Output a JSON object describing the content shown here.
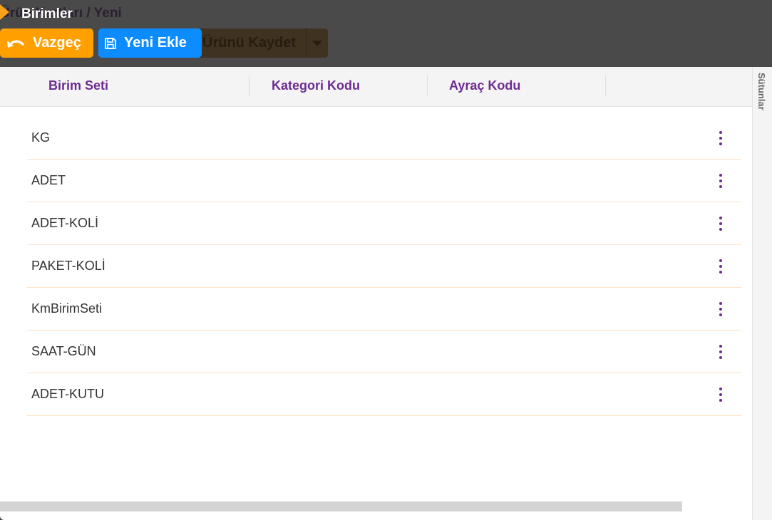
{
  "background": {
    "breadcrumb": "Ürün Kartları / Yeni",
    "save_button_label": "Ürünü Kaydet"
  },
  "modal": {
    "title": "Birimler",
    "cancel_label": "Vazgeç",
    "add_label": "Yeni Ekle",
    "columns": [
      "Birim Seti",
      "Kategori Kodu",
      "Ayraç Kodu"
    ],
    "rows": [
      "KG",
      "ADET",
      "ADET-KOLİ",
      "PAKET-KOLİ",
      "KmBirimSeti",
      "SAAT-GÜN",
      "ADET-KUTU"
    ],
    "side_tab": "Sütunlar"
  },
  "colors": {
    "accent_purple": "#6c2c91",
    "cancel_orange": "#ffa000",
    "add_blue": "#0c8cff",
    "row_divider": "#fde1c7"
  },
  "icons": {
    "cancel": "undo-arrow-icon",
    "add": "floppy-disk-icon",
    "row_menu": "kebab-menu-icon",
    "title": "chevron-right-icon",
    "save_dropdown": "caret-down-icon"
  }
}
